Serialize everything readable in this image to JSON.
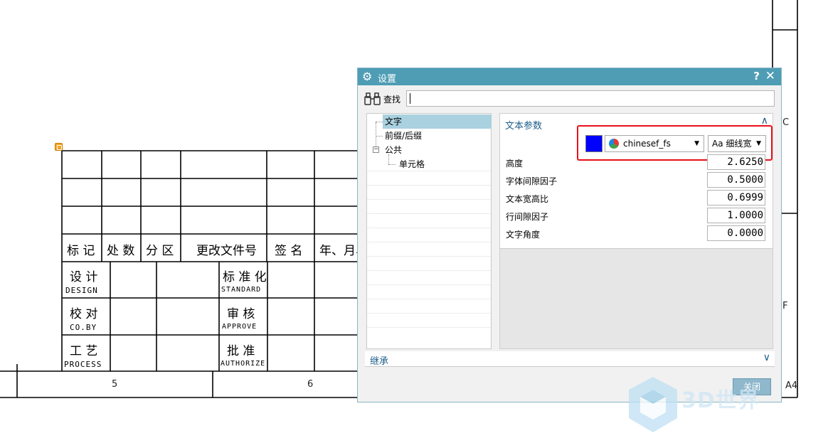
{
  "drawing": {
    "header_row": [
      "标 记",
      "处 数",
      "分 区",
      "更改文件号",
      "签 名",
      "年、月、"
    ],
    "roles": [
      {
        "cn": "设 计",
        "en": "DESIGN"
      },
      {
        "cn": "校 对",
        "en": "CO.BY"
      },
      {
        "cn": "工 艺",
        "en": "PROCESS"
      }
    ],
    "roles2": [
      {
        "cn": "标 准 化",
        "en": "STANDARD"
      },
      {
        "cn": "审  核",
        "en": "APPROVE"
      },
      {
        "cn": "批  准",
        "en": "AUTHORIZE"
      }
    ],
    "zone_numbers": [
      "5",
      "6"
    ],
    "zone_letters": [
      "C",
      "F"
    ],
    "sheet_size": "A4"
  },
  "dialog": {
    "title": "设置",
    "help_label": "?",
    "close_label": "✕",
    "find": {
      "label": "查找",
      "value": ""
    },
    "tree": [
      {
        "label": "文字",
        "selected": true
      },
      {
        "label": "前缀/后缀"
      },
      {
        "label": "公共"
      },
      {
        "label": "单元格"
      }
    ],
    "text_params": {
      "title": "文本参数",
      "color": "#0000ff",
      "font": "chinesef_fs",
      "width": "Aa 细线宽",
      "params": [
        {
          "label": "高度",
          "value": "2.6250"
        },
        {
          "label": "字体间隙因子",
          "value": "0.5000"
        },
        {
          "label": "文本宽高比",
          "value": "0.6999"
        },
        {
          "label": "行间隙因子",
          "value": "1.0000"
        },
        {
          "label": "文字角度",
          "value": "0.0000"
        }
      ]
    },
    "inherit": {
      "label": "继承"
    },
    "close_button": "关闭"
  },
  "watermark": {
    "text": "3D世界"
  }
}
